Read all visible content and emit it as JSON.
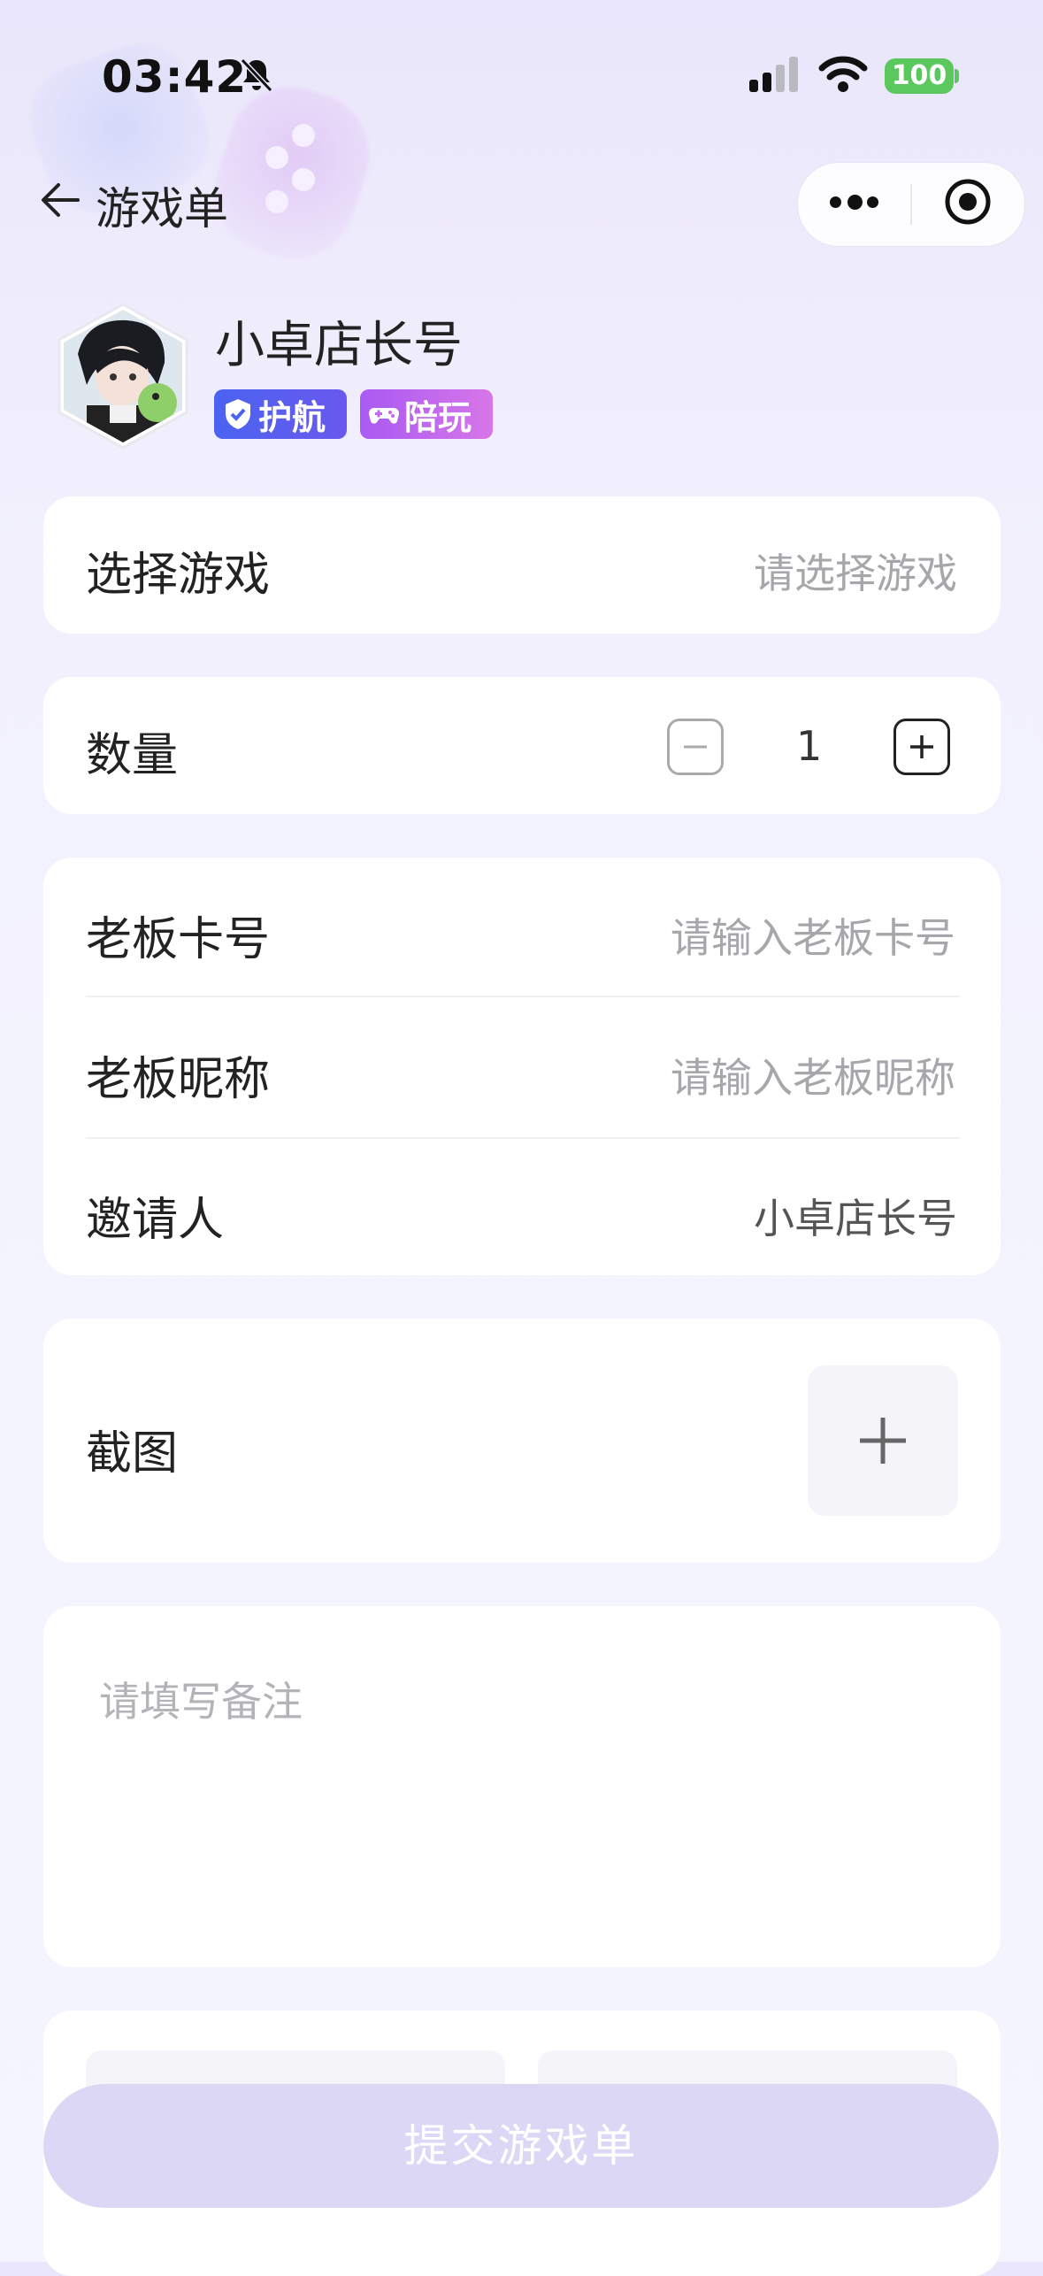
{
  "status_bar": {
    "time": "03:42",
    "battery": "100"
  },
  "nav": {
    "title": "游戏单"
  },
  "profile": {
    "name": "小卓店长号",
    "badges": [
      "护航",
      "陪玩"
    ]
  },
  "form": {
    "game": {
      "label": "选择游戏",
      "placeholder": "请选择游戏"
    },
    "quantity": {
      "label": "数量",
      "value": "1"
    },
    "boss_card": {
      "label": "老板卡号",
      "placeholder": "请输入老板卡号"
    },
    "boss_nickname": {
      "label": "老板昵称",
      "placeholder": "请输入老板昵称"
    },
    "inviter": {
      "label": "邀请人",
      "value": "小卓店长号"
    },
    "screenshot": {
      "label": "截图"
    },
    "remark": {
      "placeholder": "请填写备注"
    }
  },
  "submit_label": "提交游戏单",
  "colors": {
    "accent": "#ddd7f6",
    "badge_blue": "#4a63f0",
    "badge_purple": "#c268ed",
    "battery": "#5bc85e"
  }
}
